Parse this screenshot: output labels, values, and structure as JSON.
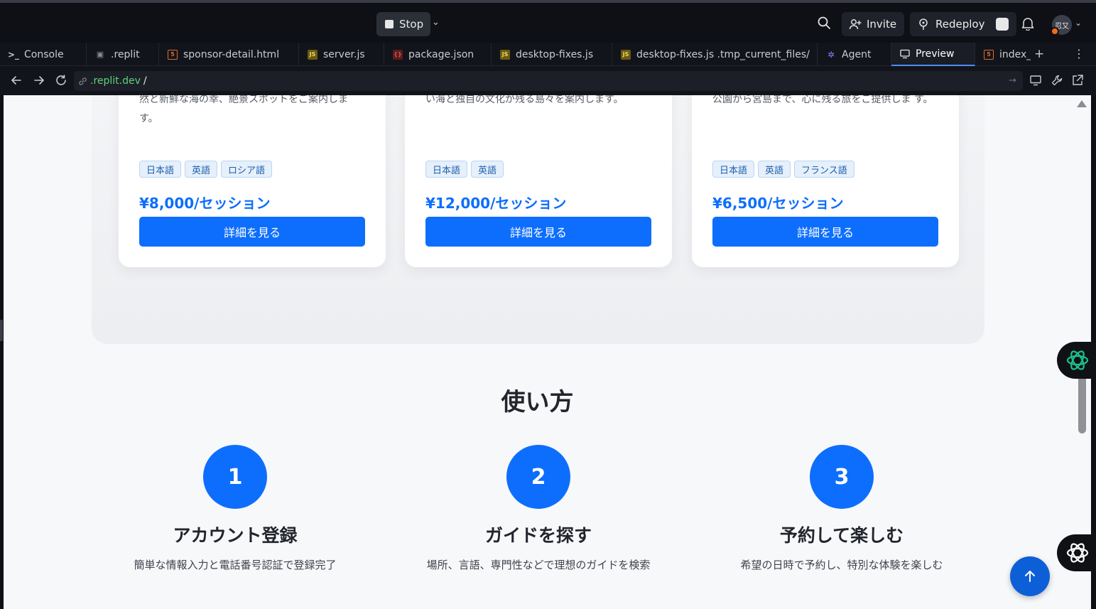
{
  "topbar": {
    "stop_label": "Stop",
    "invite_label": "Invite",
    "redeploy_label": "Redeploy",
    "avatar_text": "忍又"
  },
  "tabs": [
    {
      "label": "Console",
      "icon": "terminal-icon"
    },
    {
      "label": ".replit",
      "icon": "replit-icon"
    },
    {
      "label": "sponsor-detail.html",
      "icon": "html-icon"
    },
    {
      "label": "server.js",
      "icon": "js-icon"
    },
    {
      "label": "package.json",
      "icon": "json-icon"
    },
    {
      "label": "desktop-fixes.js",
      "icon": "js-icon"
    },
    {
      "label": "desktop-fixes.js .tmp_current_files/",
      "icon": "js-icon"
    },
    {
      "label": "Agent",
      "icon": "agent-icon"
    },
    {
      "label": "Preview",
      "icon": "preview-icon"
    },
    {
      "label": "index_",
      "icon": "html-icon"
    }
  ],
  "urlbar": {
    "host": ".replit.dev",
    "path": "/"
  },
  "cards": [
    {
      "desc": "然と新鮮な海の幸、絶景スポットをご案内しま す。",
      "tags": [
        "日本語",
        "英語",
        "ロシア語"
      ],
      "price": "¥8,000/セッション",
      "button": "詳細を見る"
    },
    {
      "desc": "い海と独自の文化が残る島々を案内します。",
      "tags": [
        "日本語",
        "英語"
      ],
      "price": "¥12,000/セッション",
      "button": "詳細を見る"
    },
    {
      "desc": "公園から宮島まで、心に残る旅をご提供しま す。",
      "tags": [
        "日本語",
        "英語",
        "フランス語"
      ],
      "price": "¥6,500/セッション",
      "button": "詳細を見る"
    }
  ],
  "howto": {
    "title": "使い方",
    "steps": [
      {
        "number": "1",
        "title": "アカウント登録",
        "desc": "簡単な情報入力と電話番号認証で登録完了"
      },
      {
        "number": "2",
        "title": "ガイドを探す",
        "desc": "場所、言語、専門性などで理想のガイドを検索"
      },
      {
        "number": "3",
        "title": "予約して楽しむ",
        "desc": "希望の日時で予約し、特別な体験を楽しむ"
      }
    ]
  },
  "colors": {
    "primary": "#0d6efd",
    "ide_bg": "#0e1016",
    "tag_bg": "#e6f0fb"
  }
}
